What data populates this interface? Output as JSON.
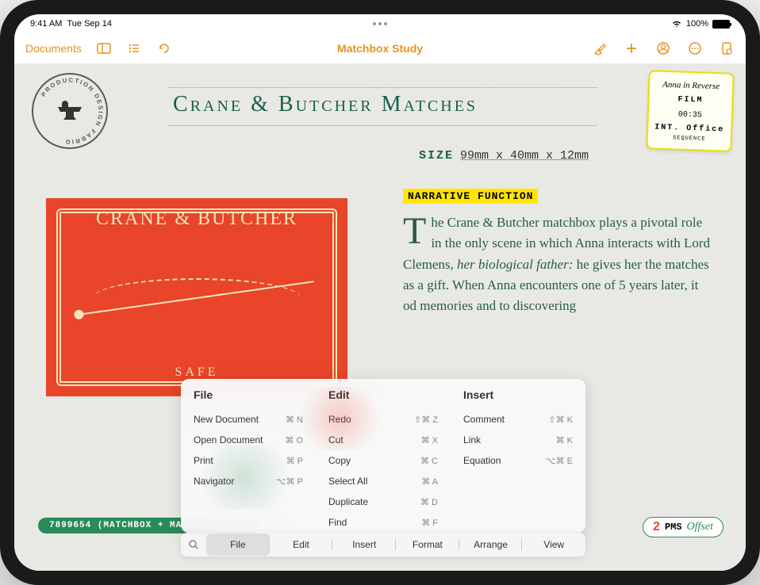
{
  "status": {
    "time": "9:41 AM",
    "date": "Tue Sep 14",
    "battery": "100%"
  },
  "toolbar": {
    "back": "Documents",
    "title": "Matchbox Study"
  },
  "doc": {
    "stamp_text": "PRODUCTION DESIGN FABRIG",
    "heading": "Crane & Butcher Matches",
    "size_label": "SIZE",
    "size_value": "99mm x 40mm x 12mm",
    "narrative_label": "NARRATIVE FUNCTION",
    "body_first": "T",
    "body_rest": "he Crane & Butcher matchbox plays a pivotal role in the only scene in which Anna interacts with Lord Clemens, ",
    "body_em": "her biological father:",
    "body_rest2": " he gives her the matches as a gift. When Anna encounters one of                      5 years later, it                     od memories and                      to discovering",
    "matchbox_brand": "CRANE & BUTCHER",
    "matchbox_safety": "SAFE",
    "footer_code": "7899654 (MATCHBOX + MATCH STICKS)",
    "pms_num": "2",
    "pms_label": "PMS",
    "pms_style": "Offset"
  },
  "film": {
    "title": "Anna in Reverse",
    "type": "FILM",
    "time": "00:35",
    "loc": "INT. Office",
    "seq": "SEQUENCE"
  },
  "shortcuts": {
    "cols": [
      {
        "head": "File",
        "items": [
          {
            "label": "New Document",
            "key": "⌘ N"
          },
          {
            "label": "Open Document",
            "key": "⌘ O"
          },
          {
            "label": "Print",
            "key": "⌘ P"
          },
          {
            "label": "Navigator",
            "key": "⌥⌘ P"
          }
        ]
      },
      {
        "head": "Edit",
        "items": [
          {
            "label": "Redo",
            "key": "⇧⌘ Z"
          },
          {
            "label": "Cut",
            "key": "⌘ X"
          },
          {
            "label": "Copy",
            "key": "⌘ C"
          },
          {
            "label": "Select All",
            "key": "⌘ A"
          },
          {
            "label": "Duplicate",
            "key": "⌘ D"
          },
          {
            "label": "Find",
            "key": "⌘ F"
          }
        ]
      },
      {
        "head": "Insert",
        "items": [
          {
            "label": "Comment",
            "key": "⇧⌘ K"
          },
          {
            "label": "Link",
            "key": "⌘ K"
          },
          {
            "label": "Equation",
            "key": "⌥⌘ E"
          }
        ]
      }
    ],
    "tabs": [
      "File",
      "Edit",
      "Insert",
      "Format",
      "Arrange",
      "View"
    ],
    "activeTab": 0
  }
}
